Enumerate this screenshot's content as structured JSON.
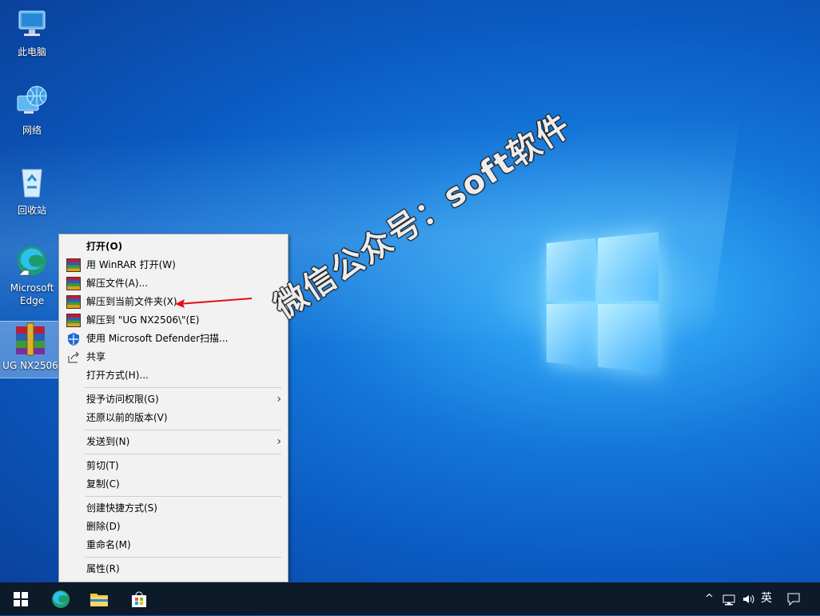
{
  "desktop": {
    "icons": [
      {
        "label": "此电脑"
      },
      {
        "label": "网络"
      },
      {
        "label": "回收站"
      },
      {
        "label": "Microsoft Edge"
      },
      {
        "label": "UG NX2506"
      }
    ]
  },
  "watermark": "微信公众号：soft软件",
  "context_menu": {
    "items": [
      {
        "label": "打开(O)"
      },
      {
        "label": "用 WinRAR 打开(W)"
      },
      {
        "label": "解压文件(A)..."
      },
      {
        "label": "解压到当前文件夹(X)"
      },
      {
        "label": "解压到 \"UG NX2506\\\"(E)"
      },
      {
        "label": "使用 Microsoft Defender扫描..."
      },
      {
        "label": "共享"
      },
      {
        "label": "打开方式(H)..."
      },
      {
        "label": "授予访问权限(G)"
      },
      {
        "label": "还原以前的版本(V)"
      },
      {
        "label": "发送到(N)"
      },
      {
        "label": "剪切(T)"
      },
      {
        "label": "复制(C)"
      },
      {
        "label": "创建快捷方式(S)"
      },
      {
        "label": "删除(D)"
      },
      {
        "label": "重命名(M)"
      },
      {
        "label": "属性(R)"
      }
    ]
  },
  "taskbar": {
    "ime": "英"
  },
  "colors": {
    "annotation_arrow": "#e0101a",
    "taskbar_bg": "#0d1a2a"
  }
}
